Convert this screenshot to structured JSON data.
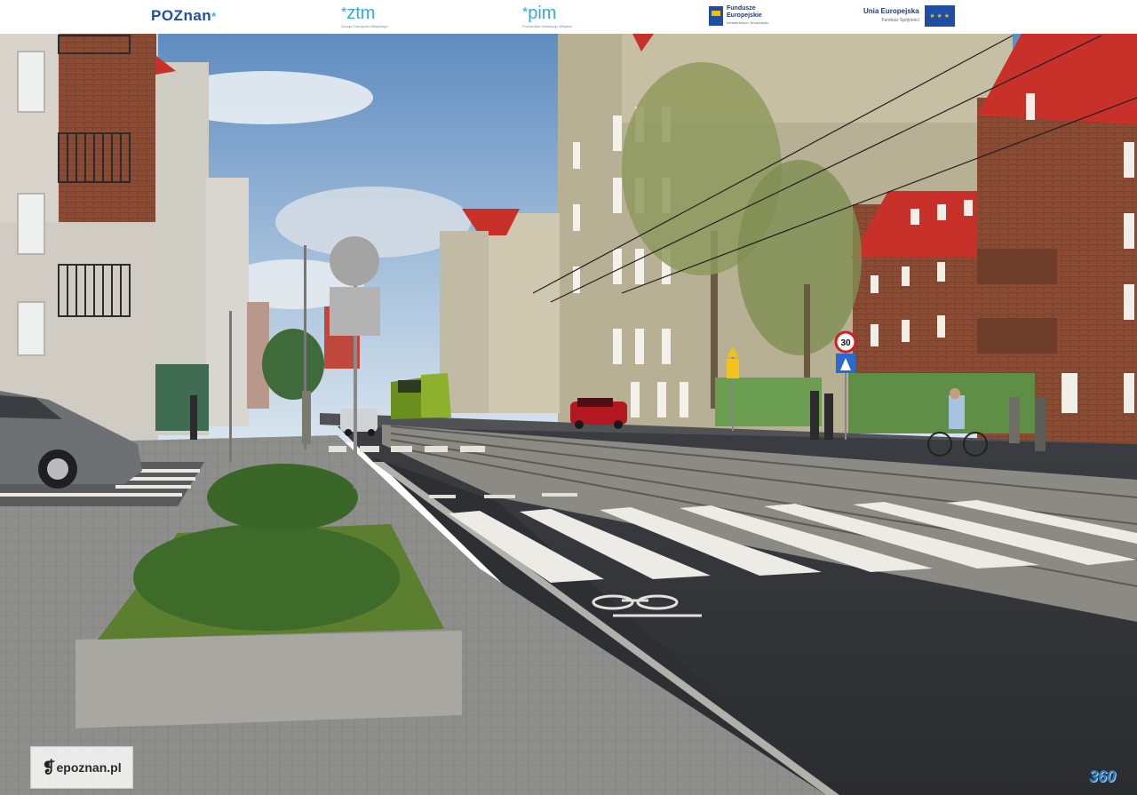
{
  "header": {
    "logos": [
      {
        "name": "poznan-logo",
        "text": "POZnan",
        "star": "*"
      },
      {
        "name": "ztm-logo",
        "text": "ztm",
        "star": "*",
        "subtitle": "Zarząd Transportu Miejskiego"
      },
      {
        "name": "pim-logo",
        "text": "pim",
        "star": "*",
        "subtitle": "Poznańskie Inwestycje Miejskie"
      },
      {
        "name": "fe-logo",
        "line1": "Fundusze",
        "line2": "Europejskie",
        "line3": "Infrastruktura i Środowisko"
      },
      {
        "name": "ue-logo",
        "line1": "Unia Europejska",
        "line2": "Fundusz Spójności"
      }
    ]
  },
  "scene": {
    "speed_limit": "30",
    "tram_color": "#6b8f1e",
    "roof_color": "#c8312a",
    "sky_color": "#7fa6cc"
  },
  "footer": {
    "watermark": "epoznan.pl",
    "badge": "360"
  }
}
